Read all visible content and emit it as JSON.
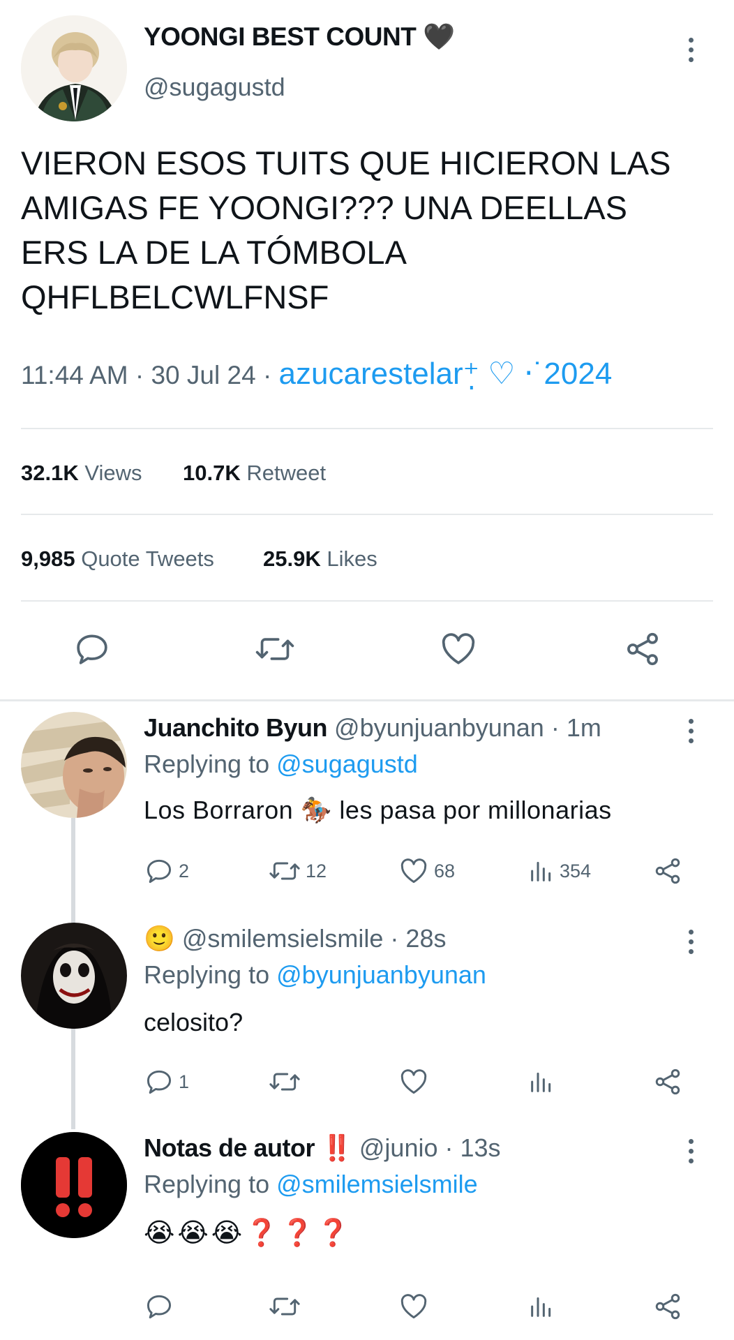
{
  "main_tweet": {
    "display_name": "YOONGI BEST COUNT",
    "name_emoji": "🖤",
    "handle": "@sugagustd",
    "text_lines": [
      "VIERON ESOS TUITS QUE HICIERON LAS",
      "AMIGAS FE YOONGI??? UNA DEELLAS",
      "ERS LA DE LA TÓMBOLA",
      "QHFLBELCWLFNSF"
    ],
    "time": "11:44 AM",
    "date": "30 Jul 24",
    "source": "azucarestelar⁺̣ ♡ ‧˙2024",
    "stats": {
      "views_count": "32.1K",
      "views_label": "Views",
      "retweets_count": "10.7K",
      "retweets_label": "Retweet",
      "quotes_count": "9,985",
      "quotes_label": "Quote Tweets",
      "likes_count": "25.9K",
      "likes_label": "Likes"
    }
  },
  "replies": [
    {
      "display_name": "Juanchito Byun",
      "handle": "@byunjuanbyunan",
      "time": "1m",
      "replying_label": "Replying to",
      "replying_to": "@sugagustd",
      "text": "Los Borraron 🏇 les pasa por millonarias",
      "replies": "2",
      "retweets": "12",
      "likes": "68",
      "views": "354"
    },
    {
      "display_name": "🙂",
      "handle": "@smilemsielsmile",
      "time": "28s",
      "replying_label": "Replying to",
      "replying_to": "@byunjuanbyunan",
      "text": "celosito?",
      "replies": "1",
      "retweets": "",
      "likes": "",
      "views": ""
    },
    {
      "display_name": "Notas de autor ‼️",
      "handle": "@junio",
      "time": "13s",
      "replying_label": "Replying to",
      "replying_to": "@smilemsielsmile",
      "text": "😭😭😭❓❓❓",
      "replies": "",
      "retweets": "",
      "likes": "",
      "views": ""
    }
  ],
  "colors": {
    "accent": "#1d9bf0",
    "text": "#0f1419",
    "muted": "#536471",
    "divider": "#e6e9eb"
  }
}
